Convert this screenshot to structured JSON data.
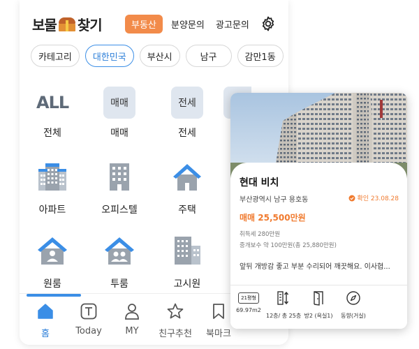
{
  "header": {
    "logo_left": "보물",
    "logo_right": "찾기",
    "nav": [
      {
        "label": "부동산",
        "active": true
      },
      {
        "label": "분양문의",
        "active": false
      },
      {
        "label": "광고문의",
        "active": false
      }
    ]
  },
  "filters": [
    {
      "label": "카테고리",
      "active": false
    },
    {
      "label": "대한민국",
      "active": true
    },
    {
      "label": "부산시",
      "active": false
    },
    {
      "label": "남구",
      "active": false
    },
    {
      "label": "감만1동",
      "active": false
    }
  ],
  "categories": [
    {
      "label": "전체",
      "icon_text": "ALL",
      "icon": "all-icon"
    },
    {
      "label": "매매",
      "icon_text": "매매",
      "icon": "sale-icon"
    },
    {
      "label": "전세",
      "icon_text": "전세",
      "icon": "jeonse-icon"
    },
    {
      "label": "아파트",
      "icon": "apartment-icon"
    },
    {
      "label": "오피스텔",
      "icon": "officetel-icon"
    },
    {
      "label": "주택",
      "icon": "house-icon"
    },
    {
      "label": "원룸",
      "icon": "one-room-icon"
    },
    {
      "label": "투룸",
      "icon": "two-room-icon"
    },
    {
      "label": "고시원",
      "icon": "gosiwon-icon"
    }
  ],
  "tabbar": [
    {
      "label": "홈",
      "icon": "home-icon",
      "active": true
    },
    {
      "label": "Today",
      "icon": "today-icon",
      "active": false
    },
    {
      "label": "MY",
      "icon": "person-icon",
      "active": false
    },
    {
      "label": "친구추천",
      "icon": "star-icon",
      "active": false
    },
    {
      "label": "북마크",
      "icon": "bookmark-icon",
      "active": false
    }
  ],
  "listing": {
    "title": "현대 비치",
    "address": "부산광역시 남구 용호동",
    "confirmed": "확인 23.08.28",
    "price": "매매 25,500만원",
    "acquisition_tax": "취득세 280만원",
    "brokerage_fee": "중개보수 약 100만원(총 25,880만원)",
    "description": "앞뒤 개방감 좋고 부분 수리되어 깨끗해요. 이사협...",
    "specs": {
      "size_badge": "21평형",
      "area": "69.97m2",
      "floor": "12층/ 총 25층",
      "rooms": "방2 (욕실1)",
      "direction": "동향(거실)"
    }
  },
  "colors": {
    "accent_orange": "#f28b4a",
    "accent_blue": "#3b8ee6",
    "price_orange": "#f07a2e",
    "icon_gray": "#9aa3ad"
  }
}
